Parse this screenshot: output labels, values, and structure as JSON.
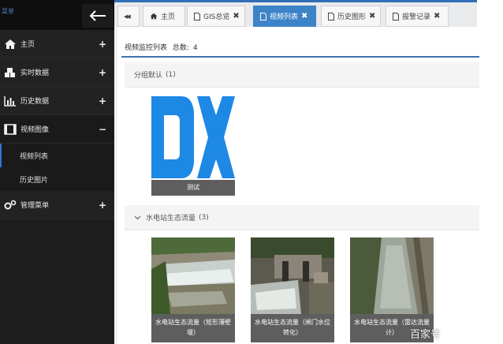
{
  "sidebar": {
    "menu_text": "菜单",
    "items": [
      {
        "label": "主页",
        "toggle": "+"
      },
      {
        "label": "实时数据",
        "toggle": "+"
      },
      {
        "label": "历史数据",
        "toggle": "+"
      },
      {
        "label": "视频图像",
        "toggle": "−"
      },
      {
        "label": "管理菜单",
        "toggle": "+"
      }
    ],
    "sub_items": [
      {
        "label": "视频列表"
      },
      {
        "label": "历史图片"
      }
    ]
  },
  "tabs": {
    "collapse_glyph": "◀◀",
    "items": [
      {
        "label": "主页",
        "icon": "home-icon",
        "close": ""
      },
      {
        "label": "GIS总览",
        "icon": "file-icon",
        "close": "✖"
      },
      {
        "label": "视频列表",
        "icon": "file-icon",
        "close": "✖"
      },
      {
        "label": "历史图形",
        "icon": "file-icon",
        "close": "✖"
      },
      {
        "label": "报警记录",
        "icon": "file-icon",
        "close": "✖"
      }
    ]
  },
  "main": {
    "list_title": "视频监控列表",
    "total_label": "总数:",
    "total_count": "4",
    "groups": [
      {
        "name": "分组默认",
        "count": "(1)",
        "cards": [
          {
            "caption": "测试"
          }
        ]
      },
      {
        "name": "水电站生态流量",
        "count": "(3)",
        "cards": [
          {
            "caption": "水电站生态流量（矩形薄壁堰）"
          },
          {
            "caption": "水电站生态流量（闸门水位转化）"
          },
          {
            "caption": "水电站生态流量（雷达流量计）"
          }
        ]
      }
    ],
    "watermark": "百家号"
  },
  "colors": {
    "sidebar_bg": "#1e1e1e",
    "accent": "#3d83c7",
    "logo_blue": "#1e88e5"
  }
}
